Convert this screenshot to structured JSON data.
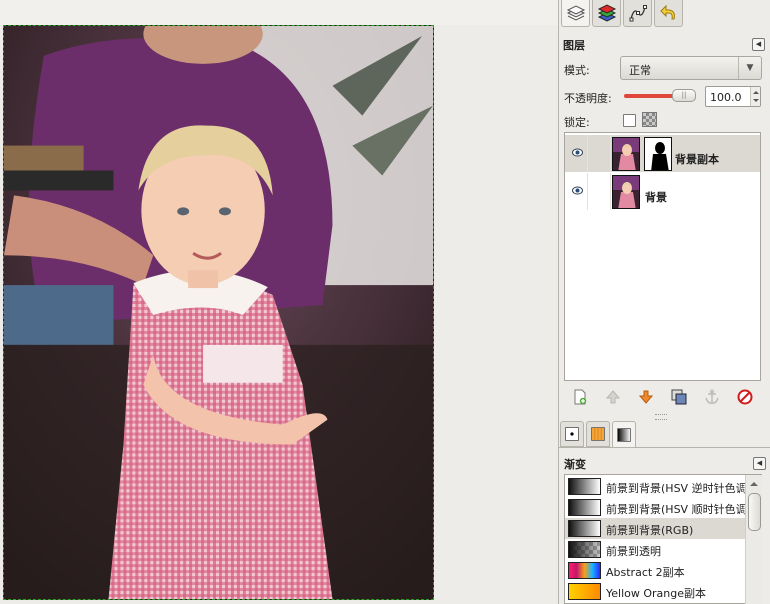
{
  "dock": {
    "tabs": [
      {
        "icon": "layers-icon"
      },
      {
        "icon": "channels-icon"
      },
      {
        "icon": "paths-icon"
      },
      {
        "icon": "undo-history-icon"
      }
    ],
    "layers_panel": {
      "title": "图层",
      "mode_label": "模式:",
      "mode_value": "正常",
      "opacity_label": "不透明度:",
      "opacity_value": "100.0",
      "opacity_fraction": 1.0,
      "lock_label": "锁定:",
      "layers": [
        {
          "name": "背景副本",
          "visible": true,
          "has_mask": true,
          "selected": true
        },
        {
          "name": "背景",
          "visible": true,
          "has_mask": false,
          "selected": false
        }
      ],
      "buttons": [
        {
          "icon": "new-layer-icon"
        },
        {
          "icon": "raise-layer-icon"
        },
        {
          "icon": "lower-layer-icon"
        },
        {
          "icon": "duplicate-layer-icon"
        },
        {
          "icon": "anchor-layer-icon"
        },
        {
          "icon": "delete-layer-icon"
        }
      ]
    },
    "lower_tabs": [
      {
        "icon": "brushes-icon"
      },
      {
        "icon": "patterns-icon"
      },
      {
        "icon": "gradients-icon"
      }
    ],
    "gradients_panel": {
      "title": "渐变",
      "items": [
        {
          "label": "前景到背景(HSV 逆时针色调)",
          "swatch": "linear-gradient(90deg,#111,#fff)",
          "selected": false
        },
        {
          "label": "前景到背景(HSV 顺时针色调)",
          "swatch": "linear-gradient(90deg,#111,#fff)",
          "selected": false
        },
        {
          "label": "前景到背景(RGB)",
          "swatch": "linear-gradient(90deg,#111,#fff)",
          "selected": true
        },
        {
          "label": "前景到透明",
          "swatch": "linear-gradient(90deg,#111,rgba(0,0,0,0)), conic-gradient(#999 0 25%,#ccc 0 50%,#999 0 75%,#ccc 0) 0 0/8px 8px",
          "selected": false
        },
        {
          "label": "Abstract 2副本",
          "swatch": "linear-gradient(90deg,#ff1b6b,#c2186b,#f7a11a,#19b5ff,#2a2aff)",
          "selected": false
        },
        {
          "label": "Yellow Orange副本",
          "swatch": "linear-gradient(90deg,#ffd100,#ff8a00)",
          "selected": false
        }
      ]
    }
  },
  "colors": {
    "selection_border": "#28a028",
    "slider_fill": "#e0473a"
  }
}
